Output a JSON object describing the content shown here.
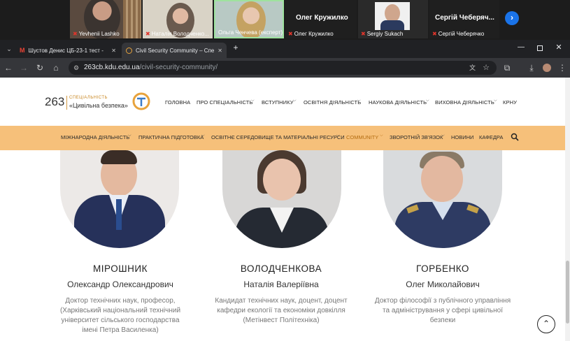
{
  "meeting": {
    "participants": [
      {
        "name": "Yevhenii Lashko"
      },
      {
        "name": "Наталія Володченко..."
      },
      {
        "name": "Ольга Ченчева (експерт)"
      },
      {
        "name": "Олег Кружилко",
        "big_label": "Олег Кружилко"
      },
      {
        "name": "Sergiy Sukach"
      },
      {
        "name": "Сергій Чеберячко",
        "big_label": "Сергій Чеберяч..."
      }
    ],
    "next_icon": "chevron-right-icon"
  },
  "browser": {
    "tabs": [
      {
        "title": "Шустов Денис ЦБ-23-1 тест - ",
        "icon": "gmail-icon"
      },
      {
        "title": "Civil Security Community – Спе",
        "icon": "site-icon"
      }
    ],
    "new_tab_label": "+",
    "url_host": "263cb.kdu.edu.ua",
    "url_path": "/civil-security-community/"
  },
  "site": {
    "logo_number": "263",
    "logo_line1": "СПЕЦІАЛЬНІСТЬ",
    "logo_line2": "«Цивільна безпека»",
    "main_menu": [
      "ГОЛОВНА",
      "ПРО СПЕЦІАЛЬНІСТЬ",
      "ВСТУПНИКУ",
      "ОСВІТНЯ ДІЯЛЬНІСТЬ",
      "НАУКОВА ДІЯЛЬНІСТЬ",
      "ВИХОВНА ДІЯЛЬНІСТЬ",
      "КРНУ"
    ],
    "sub_menu": [
      "МІЖНАРОДНА ДІЯЛЬНІСТЬ",
      "ПРАКТИЧНА ПІДГОТОВКА",
      "ОСВІТНЄ СЕРЕДОВИЩЕ ТА МАТЕРІАЛЬНІ РЕСУРСИ",
      "COMMUNITY",
      "ЗВОРОТНІЙ ЗВ'ЯЗОК",
      "НОВИНИ",
      "КАФЕДРА"
    ],
    "active_color": "#c8851e",
    "accent_color": "#f6c07a"
  },
  "people": [
    {
      "surname": "МІРОШНИК",
      "fullname": "Олександр Олександрович",
      "bio": [
        "Доктор технічних наук, професор,",
        "(Харківський національний технічний",
        "університет сільського господарства",
        "імені Петра Василенка)"
      ]
    },
    {
      "surname": "ВОЛОДЧЕНКОВА",
      "fullname": "Наталія Валеріївна",
      "bio": [
        "Кандидат технічних наук, доцент, доцент",
        "кафедри екології та економіки довкілля",
        "(Метінвест Політехніка)"
      ]
    },
    {
      "surname": "ГОРБЕНКО",
      "fullname": "Олег Миколайович",
      "bio": [
        "Доктор філософії з публічного управління",
        "та адміністрування у сфері цивільної",
        "безпеки"
      ]
    }
  ]
}
